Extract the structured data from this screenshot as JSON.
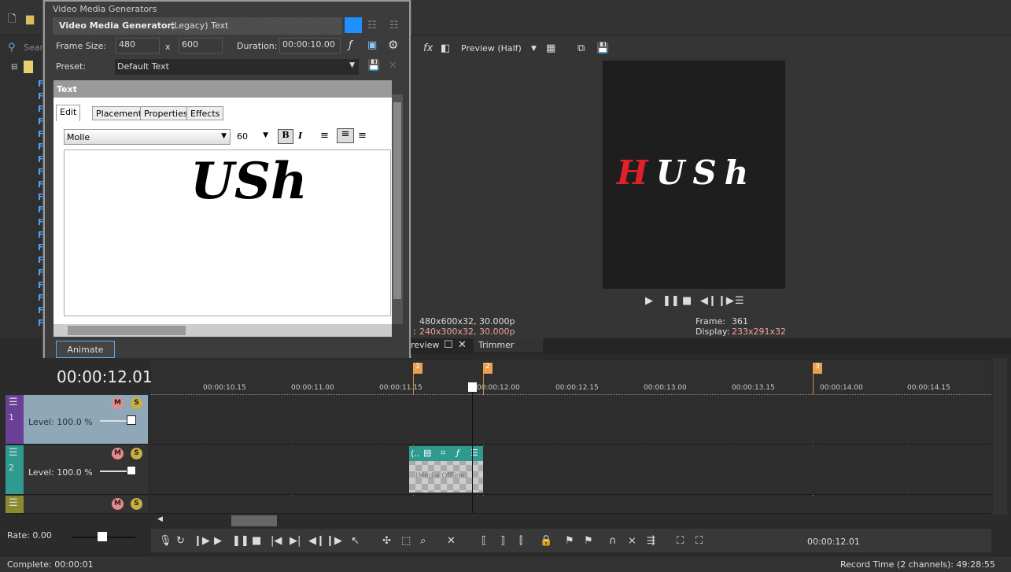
{
  "dialog": {
    "window_title": "Video Media Generators",
    "header_label": "Video Media Generator:",
    "header_value": "(Legacy) Text",
    "frame_size_label": "Frame Size:",
    "width": "480",
    "x_sep": "x",
    "height": "600",
    "duration_label": "Duration:",
    "duration": "00:00:10.00",
    "preset_label": "Preset:",
    "preset": "Default Text",
    "section": "Text",
    "tabs": [
      "Edit",
      "Placement",
      "Properties",
      "Effects"
    ],
    "font": "Molle",
    "font_size": "60",
    "bold": "B",
    "italic": "I",
    "editor_text": "USh",
    "animate": "Animate"
  },
  "explorer": {
    "search_placeholder": "Search"
  },
  "preview": {
    "quality": "Preview (Half)",
    "text_first": "H",
    "text_rest": "USh",
    "accent_red": "#e0202a",
    "project_prefix": "",
    "project": "480x600x32, 30.000p",
    "preview_prefix": ":",
    "preview_res": "240x300x32, 30.000p",
    "frame_label": "Frame:",
    "frame": "361",
    "display_label": "Display:",
    "display": "233x291x32",
    "tab_preview": "review",
    "tab_trimmer": "Trimmer"
  },
  "timeline": {
    "time": "00:00:12.01",
    "ruler": [
      "00:00:10.15",
      "00:00:11.00",
      "00:00:11.15",
      "00:00:12.00",
      "00:00:12.15",
      "00:00:13.00",
      "00:00:13.15",
      "00:00:14.00",
      "00:00:14.15"
    ],
    "markers": [
      "1",
      "2",
      "3"
    ],
    "tracks": [
      {
        "num": "1",
        "level": "Level: 100.0 %",
        "color": "#6a3f96"
      },
      {
        "num": "2",
        "level": "Level: 100.0 %",
        "color": "#2f9a8f"
      },
      {
        "num": "",
        "level": "",
        "color": "#8a8a30"
      }
    ],
    "clip_label": "(Media Offline)",
    "rate": "Rate: 0.00",
    "cursor_time": "00:00:12.01"
  },
  "status": {
    "left": "Complete: 00:00:01",
    "right": "Record Time (2 channels): 49:28:55"
  }
}
